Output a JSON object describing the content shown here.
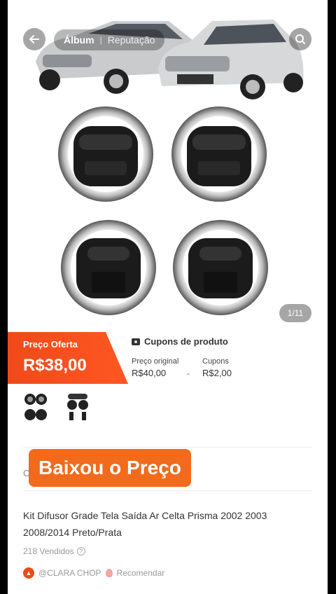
{
  "header": {
    "tabs": [
      {
        "label": "Álbum",
        "active": true
      },
      {
        "label": "Reputação",
        "active": false
      }
    ],
    "icons": {
      "back": "arrow-left-icon",
      "search": "search-icon"
    }
  },
  "gallery": {
    "counter": "1/11"
  },
  "price": {
    "offer_label": "Preço Oferta",
    "offer_value": "R$38,00",
    "coupon_title": "Cupons de produto",
    "original_label": "Preço original",
    "original_value": "R$40,00",
    "separator": "-",
    "coupons_label": "Cupons",
    "coupons_value": "R$2,00"
  },
  "promo": {
    "stub": "C",
    "badge": "Baixou o Preço"
  },
  "product": {
    "title": "Kit Difusor Grade Tela Saída Ar Celta Prisma 2002 2003 2008/2014 Preto/Prata",
    "sold": "218 Vendidos",
    "shop": "@CLARA CHOP",
    "recommend": "Recomendar"
  },
  "colors": {
    "accent": "#f04a1a",
    "badge": "#f26a1b",
    "coupon_bg": "#fde8df"
  }
}
